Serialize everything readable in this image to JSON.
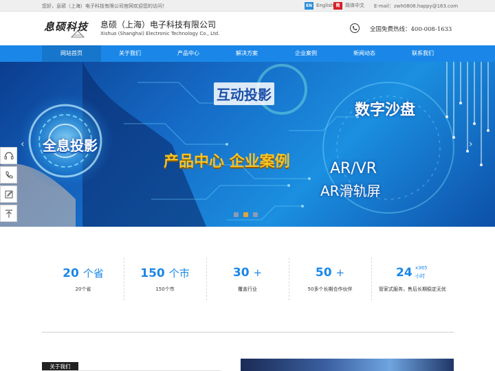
{
  "topbar": {
    "welcome": "您好，息硕（上海）电子科技有限公司官网欢迎您的访问！",
    "lang_en_flag": "EN",
    "lang_en_label": "English",
    "lang_cn_flag": "简",
    "lang_cn_label": "简体中文",
    "email": "E-mail：zwh0808.happy@163.com"
  },
  "header": {
    "logo_text": "息硕科技",
    "company_cn": "息硕（上海）电子科技有限公司",
    "company_en": "Xishuo (Shanghai) Electronic Technology Co., Ltd.",
    "hotline_label": "全国免费热线：",
    "hotline_number": "400-008-1633"
  },
  "nav": {
    "items": [
      {
        "label": "网站首页"
      },
      {
        "label": "关于我们"
      },
      {
        "label": "产品中心"
      },
      {
        "label": "解决方案"
      },
      {
        "label": "企业案例"
      },
      {
        "label": "新闻动态"
      },
      {
        "label": "联系我们"
      }
    ],
    "active_index": 0
  },
  "banner": {
    "interactive_projection": "互动投影",
    "digital_sandtable": "数字沙盘",
    "holographic_projection": "全息投影",
    "products_cases": "产品中心  企业案例",
    "ar_vr": "AR/VR",
    "ar_rail_screen": "AR滑轨屏",
    "left_arrow": "‹",
    "right_arrow": "›",
    "slide_count": 3,
    "active_slide": 1
  },
  "side_tools": [
    "headset-icon",
    "phone-icon",
    "edit-icon",
    "back-to-top-icon"
  ],
  "stats": [
    {
      "num": "20",
      "unit": "个省",
      "label": "20个省"
    },
    {
      "num": "150",
      "unit": "个市",
      "label": "150个市"
    },
    {
      "num": "30",
      "unit": "+",
      "label": "覆盖行业"
    },
    {
      "num": "50",
      "unit": "+",
      "label": "50多个长期合作伙伴"
    },
    {
      "num": "24",
      "unit_top": "x365",
      "unit_bottom": "小时",
      "label": "管家式服务，售后长期稳定无忧"
    }
  ],
  "about": {
    "tab_label": "关于我们"
  },
  "colors": {
    "brand_blue": "#1a87e8",
    "nav_active": "#1676cc",
    "accent_gold": "#f6c226",
    "dot_active": "#e7a13b"
  }
}
